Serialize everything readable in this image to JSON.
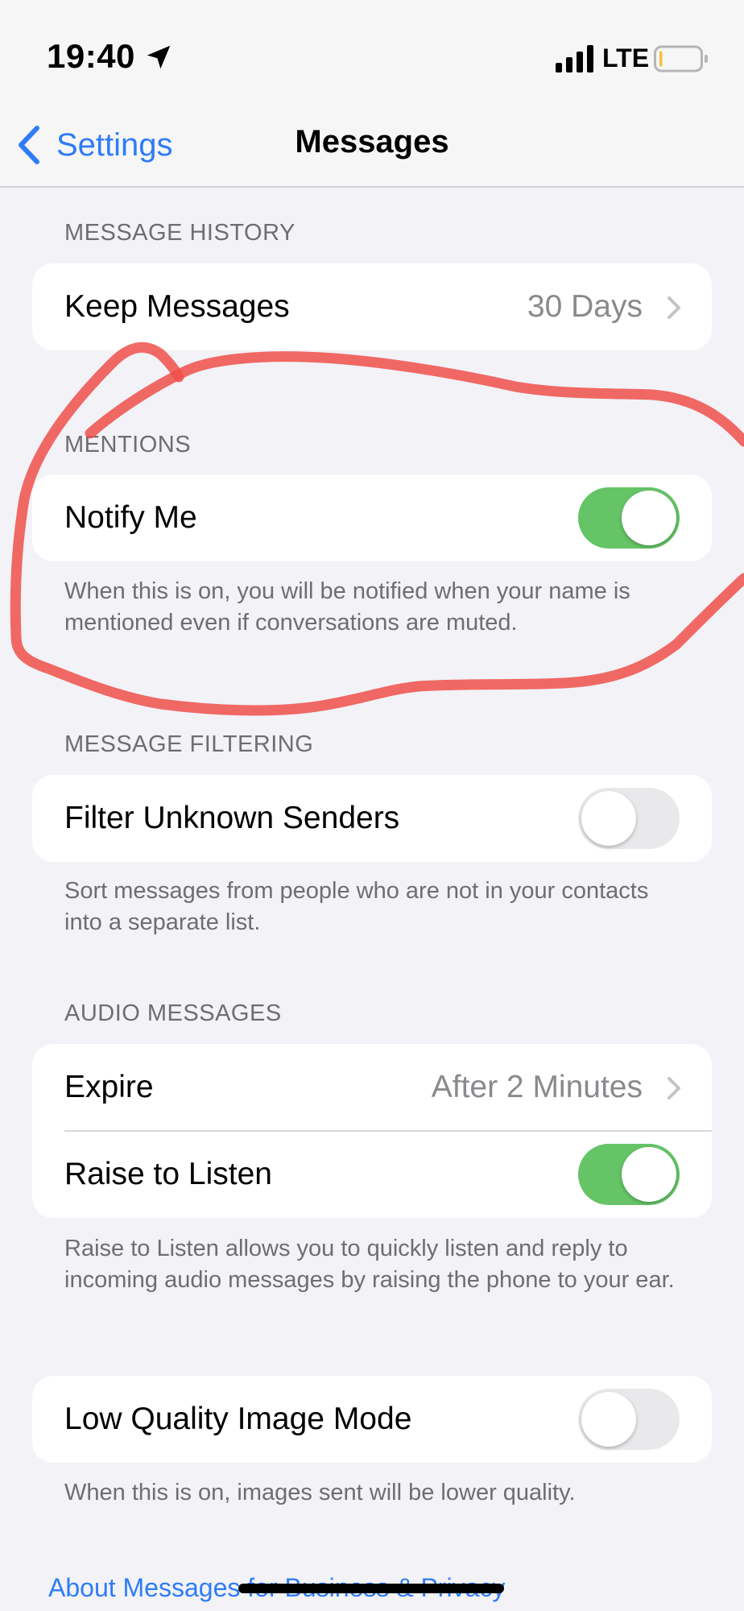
{
  "status_bar": {
    "time": "19:40",
    "network": "LTE",
    "icons": [
      "location-arrow-icon",
      "cellular-signal-icon",
      "battery-icon"
    ]
  },
  "nav": {
    "back_label": "Settings",
    "title": "Messages",
    "accent_color": "#2f7cf6"
  },
  "message_history": {
    "header": "MESSAGE HISTORY",
    "keep_messages": {
      "label": "Keep Messages",
      "value": "30 Days"
    }
  },
  "mentions": {
    "header": "MENTIONS",
    "notify_me": {
      "label": "Notify Me",
      "on": true
    },
    "footer": "When this is on, you will be notified when your name is mentioned even if conversations are muted."
  },
  "message_filtering": {
    "header": "MESSAGE FILTERING",
    "filter_unknown": {
      "label": "Filter Unknown Senders",
      "on": false
    },
    "footer": "Sort messages from people who are not in your contacts into a separate list."
  },
  "audio_messages": {
    "header": "AUDIO MESSAGES",
    "expire": {
      "label": "Expire",
      "value": "After 2 Minutes"
    },
    "raise_to_listen": {
      "label": "Raise to Listen",
      "on": true
    },
    "footer": "Raise to Listen allows you to quickly listen and reply to incoming audio messages by raising the phone to your ear."
  },
  "low_quality": {
    "low_quality_mode": {
      "label": "Low Quality Image Mode",
      "on": false
    },
    "footer": "When this is on, images sent will be lower quality."
  },
  "about_link": "About Messages for Business & Privacy",
  "colors": {
    "toggle_on": "#65c466",
    "toggle_off": "#e9e9eb",
    "annotation": "#f0504a"
  }
}
